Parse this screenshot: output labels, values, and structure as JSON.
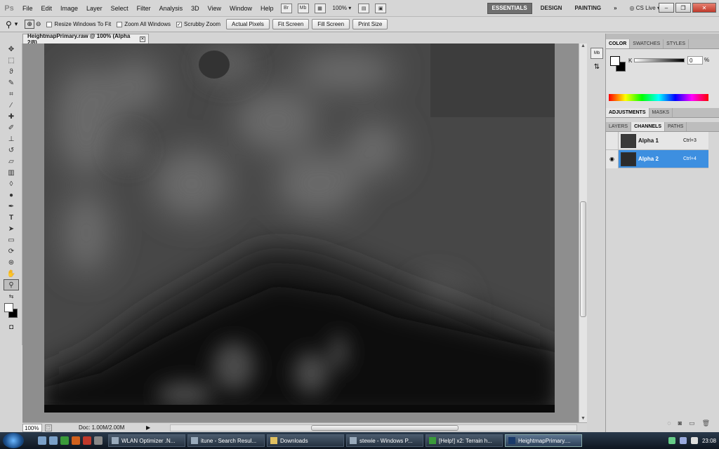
{
  "app": {
    "logo": "Ps"
  },
  "menubar": {
    "items": [
      "File",
      "Edit",
      "Image",
      "Layer",
      "Select",
      "Filter",
      "Analysis",
      "3D",
      "View",
      "Window",
      "Help"
    ],
    "zoom": "100%",
    "workspaces": [
      "ESSENTIALS",
      "DESIGN",
      "PAINTING"
    ],
    "overflow": "»",
    "cslive": "CS Live"
  },
  "options": {
    "checkboxes": [
      {
        "label": "Resize Windows To Fit",
        "checked": false
      },
      {
        "label": "Zoom All Windows",
        "checked": false
      },
      {
        "label": "Scrubby Zoom",
        "checked": true
      }
    ],
    "buttons": [
      "Actual Pixels",
      "Fit Screen",
      "Fill Screen",
      "Print Size"
    ]
  },
  "document": {
    "tab_title": "HeightmapPrimary.raw @ 100% (Alpha 2/8)",
    "status_zoom": "100%",
    "status_doc": "Doc: 1.00M/2.00M"
  },
  "panels": {
    "color_tabs": [
      "COLOR",
      "SWATCHES",
      "STYLES"
    ],
    "k_label": "K",
    "k_value": "0",
    "k_unit": "%",
    "adjust_tabs": [
      "ADJUSTMENTS",
      "MASKS"
    ],
    "layer_tabs": [
      "LAYERS",
      "CHANNELS",
      "PATHS"
    ],
    "channels": [
      {
        "name": "Alpha 1",
        "shortcut": "Ctrl+3",
        "visible": false,
        "selected": false
      },
      {
        "name": "Alpha 2",
        "shortcut": "Ctrl+4",
        "visible": true,
        "selected": true
      }
    ]
  },
  "taskbar": {
    "tasks": [
      {
        "label": "WLAN Optimizer .N...",
        "active": false
      },
      {
        "label": "itune - Search Resul...",
        "active": false
      },
      {
        "label": "Downloads",
        "active": false
      },
      {
        "label": "stewie - Windows P...",
        "active": false
      },
      {
        "label": "[Help!] x2: Terrain h...",
        "active": false
      },
      {
        "label": "HeightmapPrimary....",
        "active": true
      }
    ],
    "clock": "23:08"
  }
}
